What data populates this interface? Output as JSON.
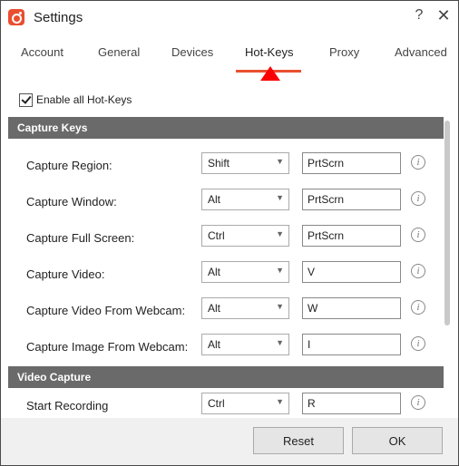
{
  "window": {
    "title": "Settings",
    "help_label": "?",
    "close_label": "✕"
  },
  "tabs": [
    {
      "label": "Account"
    },
    {
      "label": "General"
    },
    {
      "label": "Devices"
    },
    {
      "label": "Hot-Keys",
      "active": true
    },
    {
      "label": "Proxy"
    },
    {
      "label": "Advanced"
    }
  ],
  "enable_all": {
    "label": "Enable all Hot-Keys",
    "checked": true
  },
  "sections": [
    {
      "title": "Capture Keys",
      "rows": [
        {
          "label": "Capture Region:",
          "modifier": "Shift",
          "key": "PrtScrn"
        },
        {
          "label": "Capture Window:",
          "modifier": "Alt",
          "key": "PrtScrn"
        },
        {
          "label": "Capture Full Screen:",
          "modifier": "Ctrl",
          "key": "PrtScrn"
        },
        {
          "label": "Capture Video:",
          "modifier": "Alt",
          "key": "V"
        },
        {
          "label": "Capture Video From Webcam:",
          "modifier": "Alt",
          "key": "W"
        },
        {
          "label": "Capture Image From Webcam:",
          "modifier": "Alt",
          "key": "I"
        }
      ]
    },
    {
      "title": "Video Capture",
      "rows": [
        {
          "label": "Start Recording",
          "modifier": "Ctrl",
          "key": "R"
        }
      ]
    }
  ],
  "footer": {
    "reset_label": "Reset",
    "ok_label": "OK"
  },
  "icons": {
    "info": "i",
    "dropdown": "▼"
  },
  "colors": {
    "accent": "#e94f2f",
    "section_header": "#6a6a6a",
    "footer_bg": "#f0f0f0"
  }
}
